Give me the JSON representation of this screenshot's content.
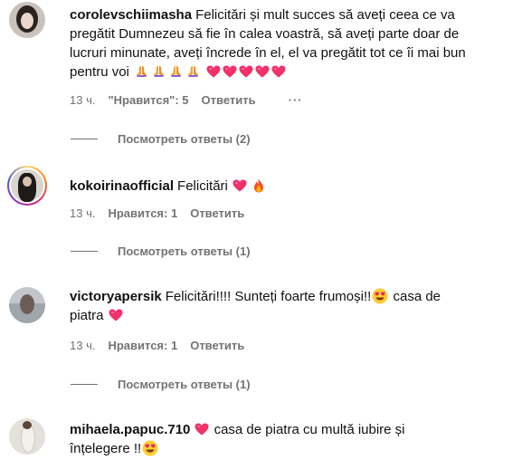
{
  "comments": [
    {
      "username": "corolevschiimasha",
      "text": "Felicitări și mult succes să aveți ceea ce va pregătit Dumnezeu să fie în calea voastră, să aveți parte doar de lucruri minunate, aveți încrede în el, el va pregătit tot ce îi mai bun pentru voi",
      "time": "13 ч.",
      "likes": "\"Нравится\": 5",
      "reply": "Ответить",
      "more": "···",
      "view_replies": "Посмотреть ответы (2)",
      "emoji_icons": [
        "folded-hands-icon",
        "folded-hands-icon",
        "folded-hands-icon",
        "folded-hands-icon",
        "heart-icon",
        "heart-icon",
        "heart-icon",
        "heart-icon",
        "heart-icon"
      ]
    },
    {
      "username": "kokoirinaofficial",
      "text": "Felicitări",
      "time": "13 ч.",
      "likes": "Нравится: 1",
      "reply": "Ответить",
      "view_replies": "Посмотреть ответы (1)",
      "emoji_icons": [
        "heart-icon",
        "fire-icon"
      ]
    },
    {
      "username": "victoryapersik",
      "text": "Felicitări!!!! Sunteți foarte frumoși!!",
      "text_after": "casa de piatra",
      "time": "13 ч.",
      "likes": "Нравится: 1",
      "reply": "Ответить",
      "view_replies": "Посмотреть ответы (1)",
      "emoji_icons": [
        "heart-eyes-icon",
        "heart-icon"
      ]
    },
    {
      "username": "mihaela.papuc.710",
      "text": "casa de piatra cu multă iubire și înțelegere !!",
      "emoji_icons": [
        "heart-icon",
        "heart-eyes-icon"
      ]
    }
  ],
  "colors": {
    "text": "#111111",
    "secondary": "#737373",
    "heart": "#ff3040"
  }
}
